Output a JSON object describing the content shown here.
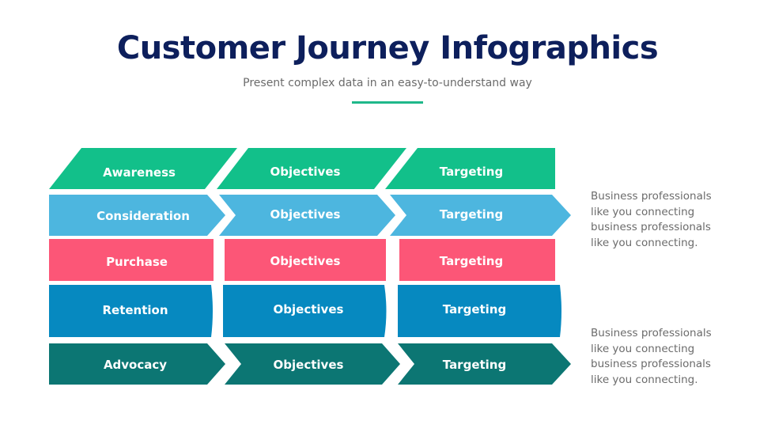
{
  "header": {
    "title": "Customer Journey Infographics",
    "subtitle": "Present complex data in an easy-to-understand way",
    "accent_color": "#1fb88a"
  },
  "rows": [
    {
      "stage": "Awareness",
      "color": "#12c08a",
      "shape": "parallelogram",
      "cells": [
        "Awareness",
        "Objectives",
        "Targeting"
      ]
    },
    {
      "stage": "Consideration",
      "color": "#4db6df",
      "shape": "chevron",
      "cells": [
        "Consideration",
        "Objectives",
        "Targeting"
      ]
    },
    {
      "stage": "Purchase",
      "color": "#fc5677",
      "shape": "rectangle",
      "cells": [
        "Purchase",
        "Objectives",
        "Targeting"
      ]
    },
    {
      "stage": "Retention",
      "color": "#0689c0",
      "shape": "rounded-rectangle",
      "cells": [
        "Retention",
        "Objectives",
        "Targeting"
      ]
    },
    {
      "stage": "Advocacy",
      "color": "#0c7673",
      "shape": "chevron",
      "cells": [
        "Advocacy",
        "Objectives",
        "Targeting"
      ]
    }
  ],
  "notes": [
    {
      "text": "Business professionals like you connecting business professionals like you connecting."
    },
    {
      "text": "Business professionals like you connecting business professionals like you connecting."
    }
  ]
}
